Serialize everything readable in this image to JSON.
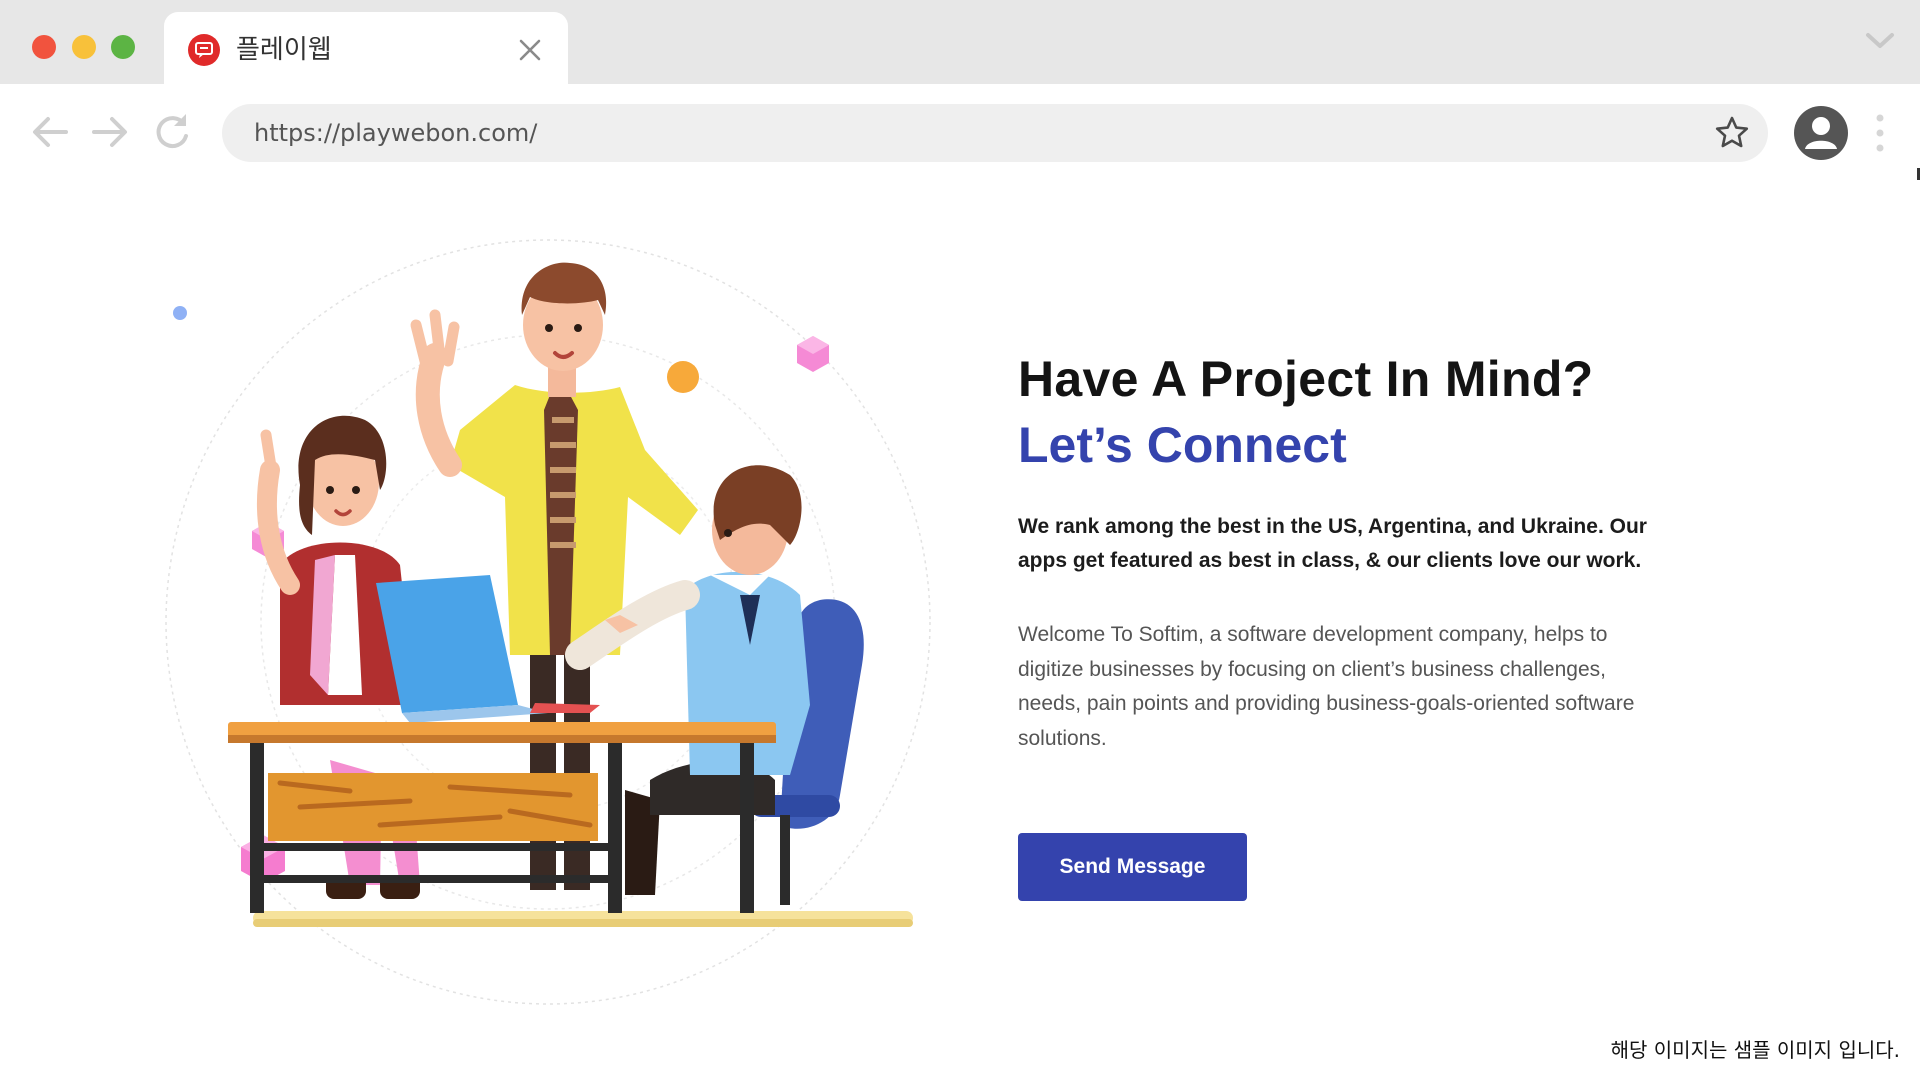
{
  "browser": {
    "tab": {
      "title": "플레이웹",
      "favicon": "chat-bubble-icon"
    },
    "address_bar": {
      "url": "https://playwebon.com/"
    },
    "icons": {
      "back": "arrow-left-icon",
      "forward": "arrow-right-icon",
      "reload": "reload-icon",
      "bookmark": "star-icon",
      "profile": "user-icon",
      "menu": "more-vertical-icon",
      "tabs": "chevron-down-icon"
    },
    "traffic_lights": {
      "close_color": "#f1533e",
      "minimize_color": "#f8c13a",
      "maximize_color": "#5cb444"
    }
  },
  "hero": {
    "heading_line1": "Have A Project In Mind?",
    "heading_line2": "Let’s Connect",
    "lead": "We rank among the best in the US, Argentina, and Ukraine. Our apps get featured as best in class, & our clients love our work.",
    "body": "Welcome To Softim, a software development company, helps to digitize businesses by focusing on client’s business challenges, needs, pain points and providing business-goals-oriented software solutions.",
    "cta_label": "Send Message",
    "accent_color": "#3443ad"
  },
  "footer_note": "해당 이미지는 샘플 이미지 입니다."
}
